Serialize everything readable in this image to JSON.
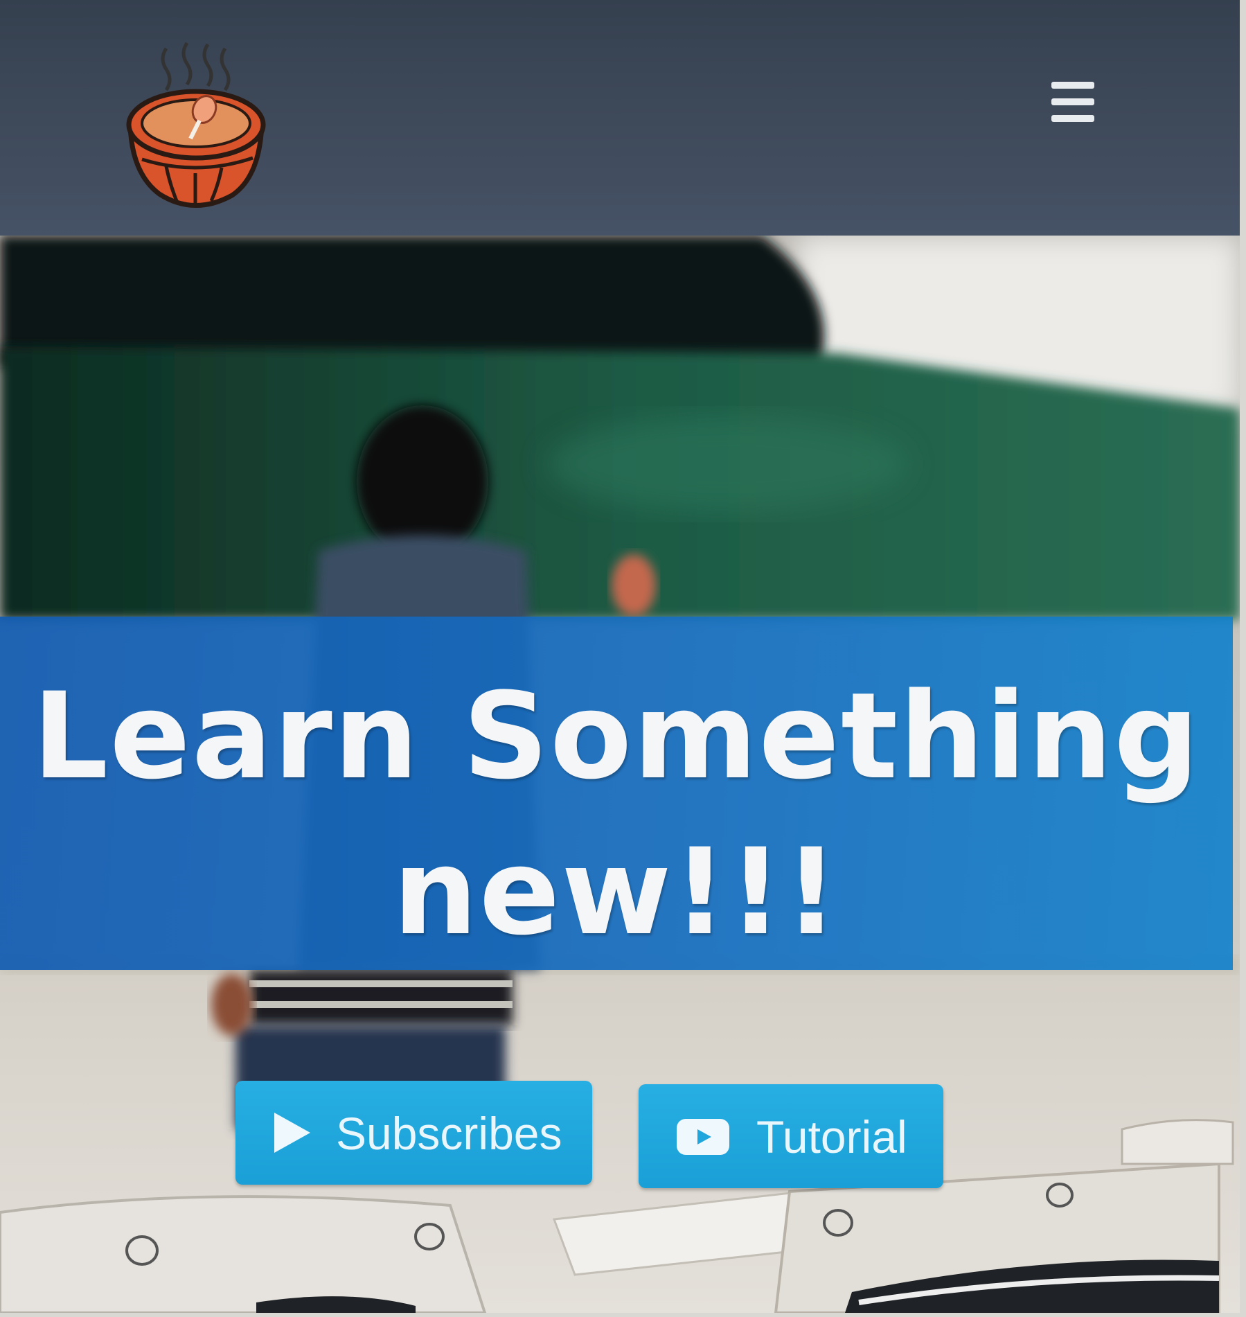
{
  "header": {
    "logo_icon": "soup-bowl-logo-icon",
    "menu_icon": "hamburger-menu-icon"
  },
  "hero": {
    "background": "classroom-photo",
    "headline": "Learn Something new!!!",
    "buttons": [
      {
        "label": "Subscribes",
        "icon": "play-icon"
      },
      {
        "label": "Tutorial",
        "icon": "youtube-icon"
      }
    ]
  },
  "colors": {
    "navbar": "#3f4a5b",
    "banner": "#1668bc",
    "button": "#1fa6dc",
    "logo_bowl": "#d9532b"
  }
}
